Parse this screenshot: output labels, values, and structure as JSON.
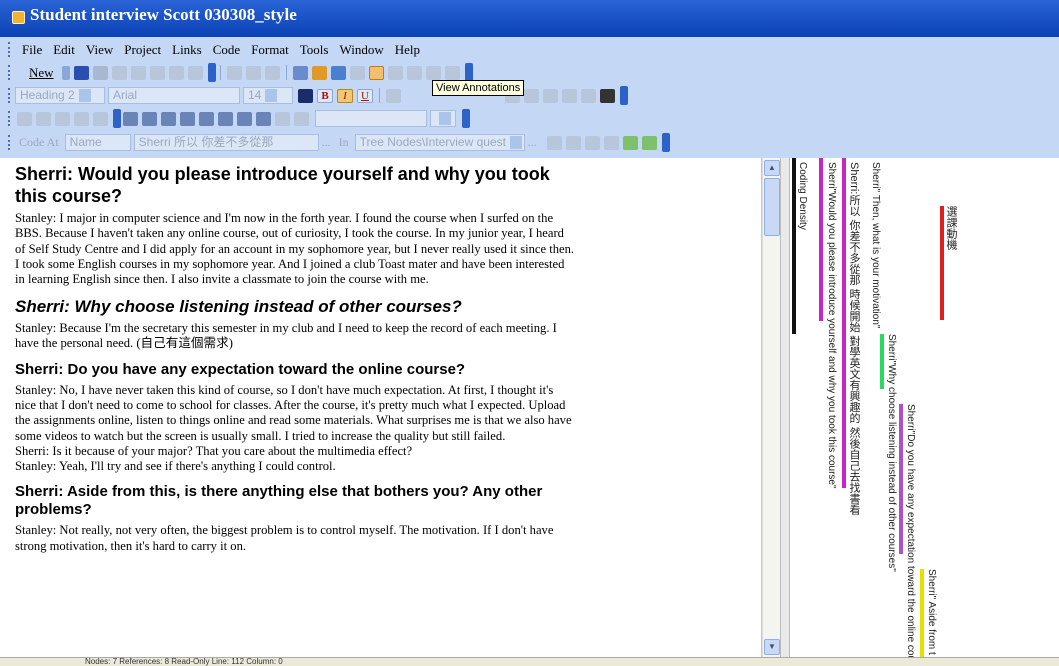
{
  "window": {
    "title": "Student interview Scott 030308_style"
  },
  "menu": [
    "File",
    "Edit",
    "View",
    "Project",
    "Links",
    "Code",
    "Format",
    "Tools",
    "Window",
    "Help"
  ],
  "toolbar1": {
    "new_label": "New",
    "tooltip": "View Annotations"
  },
  "format_bar": {
    "style": "Heading 2",
    "font": "Arial",
    "size": "14",
    "bold": "B",
    "italic": "I",
    "underline": "U"
  },
  "coding_bar": {
    "code_at": "Code At",
    "name": "Name",
    "text_value": "Sherri 所以 你差不多從那",
    "in": "In",
    "nodes": "Tree Nodes\\Interview quest",
    "ellipsis": "..."
  },
  "document": {
    "q1": "Sherri: Would you please introduce yourself and why you took this course?",
    "a1": "Stanley: I major in computer science and I'm now in the forth year. I found the course when I surfed on the BBS. Because I haven't taken any online course, out of curiosity, I took the course.  In my junior year, I heard of Self Study Centre and I did apply for an account in my sophomore year, but I never really used it since then.  I took some English courses in my sophomore year.  And I joined a club Toast mater and have been interested in learning English since then. I also invite a classmate to join the course with me.",
    "q2": "Sherri: Why choose listening instead of other courses?",
    "a2": "Stanley: Because I'm the secretary this semester in my club and I need to keep the record of each meeting.  I have the personal need. (自己有這個需求)",
    "q3": "Sherri: Do you have any expectation toward the online course?",
    "a3_1": "Stanley: No, I have never taken this kind of course, so I don't have much expectation. At first, I thought it's nice that I don't need to come to school for classes.  After the course, it's pretty much what I expected. Upload the assignments online, listen to things online and read some materials.  What surprises me is that we also have some videos to watch but the screen is usually small. I tried to increase the quality but still failed.",
    "a3_2": "Sherri: Is it because of your major? That you care about the multimedia effect?",
    "a3_3": "Stanley: Yeah, I'll try and see if there's anything I could control.",
    "q4": "Sherri: Aside from this, is there anything else that bothers you? Any other problems?",
    "a4": "Stanley: Not really, not very often, the biggest problem is to control myself. The motivation. If I don't have strong motivation, then it's hard to carry it on."
  },
  "coding_stripes": {
    "density": "Coding Density",
    "s1": "Sherri\"Would you please introduce yourself and why you took this course\"",
    "s2": "Sherri:所以 你差不多從那 時候開始 對學英文有興趣的 然後自己去找書看",
    "s3": "Sherri\" Then, what is your motivation\"",
    "s4": "選課動機",
    "s5": "Sherri\"Why choose listening instead of other courses\"",
    "s6": "Sherri\"Do you have any expectation toward the online cou",
    "s7": "Sherri\" Aside from t"
  },
  "status": {
    "text": "Nodes: 7  References: 8   Read-Only  Line: 112 Column: 0"
  },
  "colors": {
    "title_bar": "#0b43b5",
    "toolbar": "#c4d8f5",
    "magenta": "#c825c8",
    "red": "#e02020",
    "green": "#2bd860",
    "purple": "#b050c8",
    "yellow": "#e6e000"
  }
}
